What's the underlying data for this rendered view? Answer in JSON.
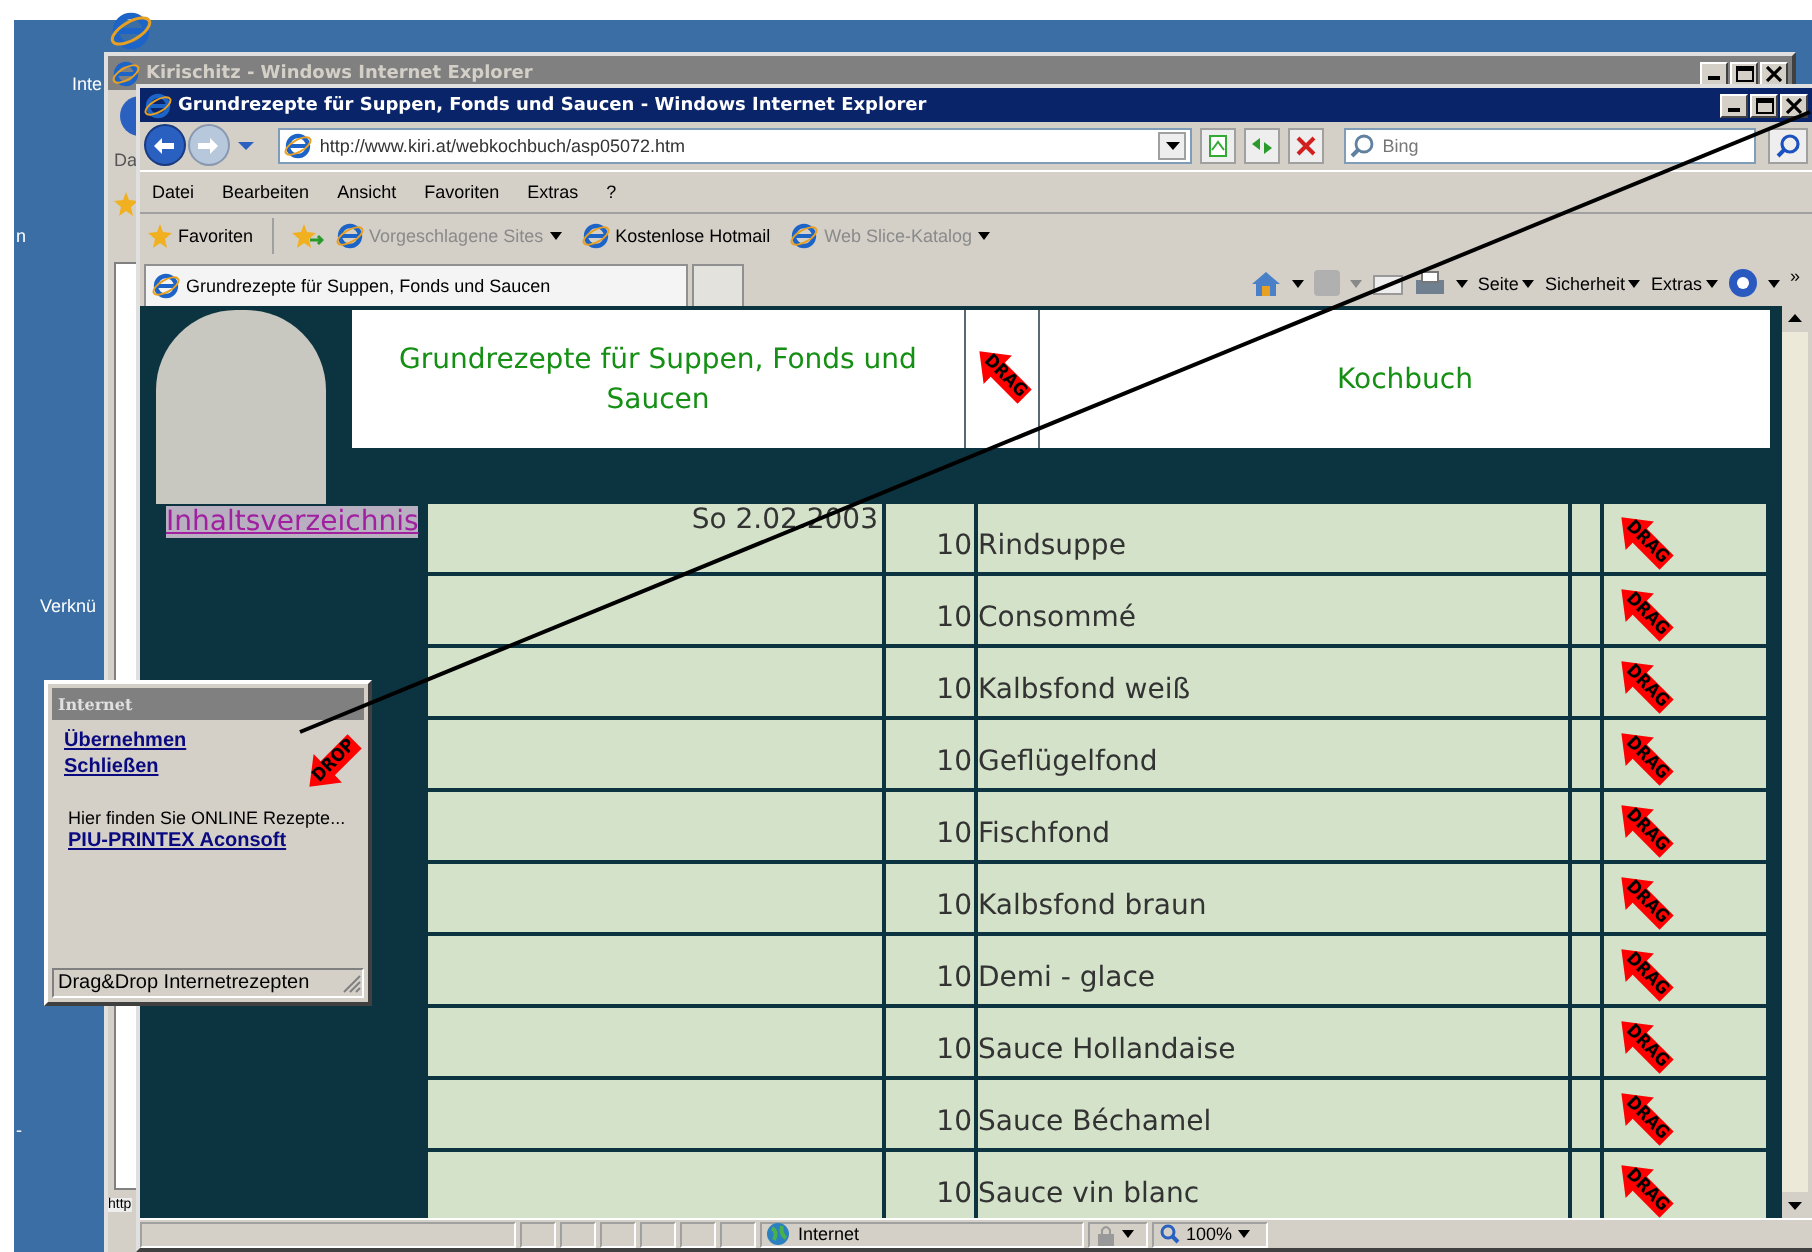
{
  "desktop": {
    "icon_labels": [
      "Inte",
      "n",
      "Verknü",
      "-"
    ]
  },
  "back_window": {
    "title": "Kirischitz - Windows Internet Explorer",
    "active": false,
    "menu_fragment": "Da",
    "status_fragment": "http"
  },
  "window": {
    "title": "Grundrezepte für Suppen, Fonds und Saucen - Windows Internet Explorer",
    "active": true,
    "address": "http://www.kiri.at/webkochbuch/asp05072.htm",
    "search_placeholder": "Bing",
    "menu": [
      "Datei",
      "Bearbeiten",
      "Ansicht",
      "Favoriten",
      "Extras",
      "?"
    ],
    "favorites_button": "Favoriten",
    "favorite_links": [
      {
        "label": "Vorgeschlagene Sites",
        "disabled": true,
        "dropdown": true
      },
      {
        "label": "Kostenlose Hotmail",
        "disabled": false,
        "dropdown": false
      },
      {
        "label": "Web Slice-Katalog",
        "disabled": true,
        "dropdown": true
      }
    ],
    "tab": "Grundrezepte für Suppen, Fonds und Saucen",
    "commands": [
      "Seite",
      "Sicherheit",
      "Extras"
    ],
    "overflow": "»",
    "status": {
      "zone": "Internet",
      "zoom": "100%"
    }
  },
  "page": {
    "title": "Grundrezepte für Suppen, Fonds und Saucen",
    "header_drag": "DRAG",
    "book": "Kochbuch",
    "toc_link": "Inhaltsverzeichnis",
    "date": "So  2.02.2003",
    "rows": [
      {
        "qty": "10",
        "name": "Rindsuppe",
        "drag": "DRAG"
      },
      {
        "qty": "10",
        "name": "Consommé",
        "drag": "DRAG"
      },
      {
        "qty": "10",
        "name": "Kalbsfond weiß",
        "drag": "DRAG"
      },
      {
        "qty": "10",
        "name": "Geflügelfond",
        "drag": "DRAG"
      },
      {
        "qty": "10",
        "name": "Fischfond",
        "drag": "DRAG"
      },
      {
        "qty": "10",
        "name": "Kalbsfond braun",
        "drag": "DRAG"
      },
      {
        "qty": "10",
        "name": "Demi - glace",
        "drag": "DRAG"
      },
      {
        "qty": "10",
        "name": "Sauce Hollandaise",
        "drag": "DRAG"
      },
      {
        "qty": "10",
        "name": "Sauce Béchamel",
        "drag": "DRAG"
      },
      {
        "qty": "10",
        "name": "Sauce vin blanc",
        "drag": "DRAG"
      }
    ]
  },
  "popup": {
    "title": "Internet",
    "links": [
      "Übernehmen",
      "Schließen"
    ],
    "drop": "DROP",
    "text": "Hier finden Sie ONLINE Rezepte...",
    "link": "PIU-PRINTEX Aconsoft",
    "status": "Drag&Drop Internetrezepten"
  }
}
